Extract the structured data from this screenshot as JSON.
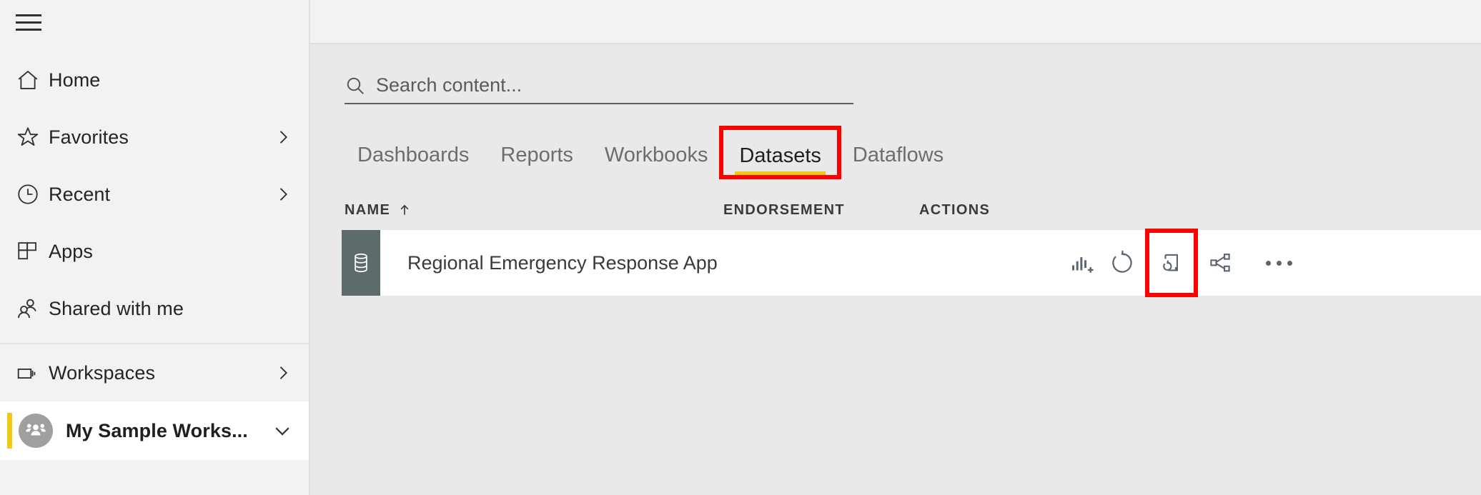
{
  "sidebar": {
    "menu_toggle": "hamburger-menu",
    "items": [
      {
        "label": "Home",
        "icon": "home-icon",
        "chevron": false
      },
      {
        "label": "Favorites",
        "icon": "star-icon",
        "chevron": true
      },
      {
        "label": "Recent",
        "icon": "clock-icon",
        "chevron": true
      },
      {
        "label": "Apps",
        "icon": "apps-grid-icon",
        "chevron": false
      },
      {
        "label": "Shared with me",
        "icon": "people-icon",
        "chevron": false
      }
    ],
    "workspaces": {
      "label": "Workspaces",
      "icon": "workspaces-stack-icon",
      "chevron": true
    },
    "active_workspace": {
      "label": "My Sample Works...",
      "avatar_icon": "group-avatar-icon",
      "chevron": "chevron-down-icon",
      "accent_color": "#f2c811"
    }
  },
  "search": {
    "placeholder": "Search content...",
    "value": "",
    "icon": "search-icon"
  },
  "tabs": [
    {
      "label": "Dashboards",
      "active": false,
      "highlighted": false
    },
    {
      "label": "Reports",
      "active": false,
      "highlighted": false
    },
    {
      "label": "Workbooks",
      "active": false,
      "highlighted": false
    },
    {
      "label": "Datasets",
      "active": true,
      "highlighted": true
    },
    {
      "label": "Dataflows",
      "active": false,
      "highlighted": false
    }
  ],
  "table": {
    "columns": {
      "name": "NAME",
      "sort_indicator": "↑",
      "endorsement": "ENDORSEMENT",
      "actions": "ACTIONS"
    },
    "rows": [
      {
        "name": "Regional Emergency Response App",
        "type_icon": "dataset-database-icon",
        "endorsement": "",
        "actions": [
          {
            "name": "create-report-icon",
            "label": "Create report",
            "highlighted": false
          },
          {
            "name": "refresh-now-icon",
            "label": "Refresh now",
            "highlighted": false
          },
          {
            "name": "schedule-refresh-icon",
            "label": "Schedule refresh",
            "highlighted": true
          },
          {
            "name": "share-icon",
            "label": "Share",
            "highlighted": false
          },
          {
            "name": "more-options-icon",
            "label": "More options",
            "highlighted": false
          }
        ]
      }
    ]
  },
  "colors": {
    "accent_yellow": "#f2c811",
    "annotation_red": "#ff0000",
    "sidebar_bg": "#f3f2f1",
    "content_bg": "#e9e9e9",
    "row_bg": "#ffffff",
    "dataset_icon_bg": "#5d6b6b"
  }
}
